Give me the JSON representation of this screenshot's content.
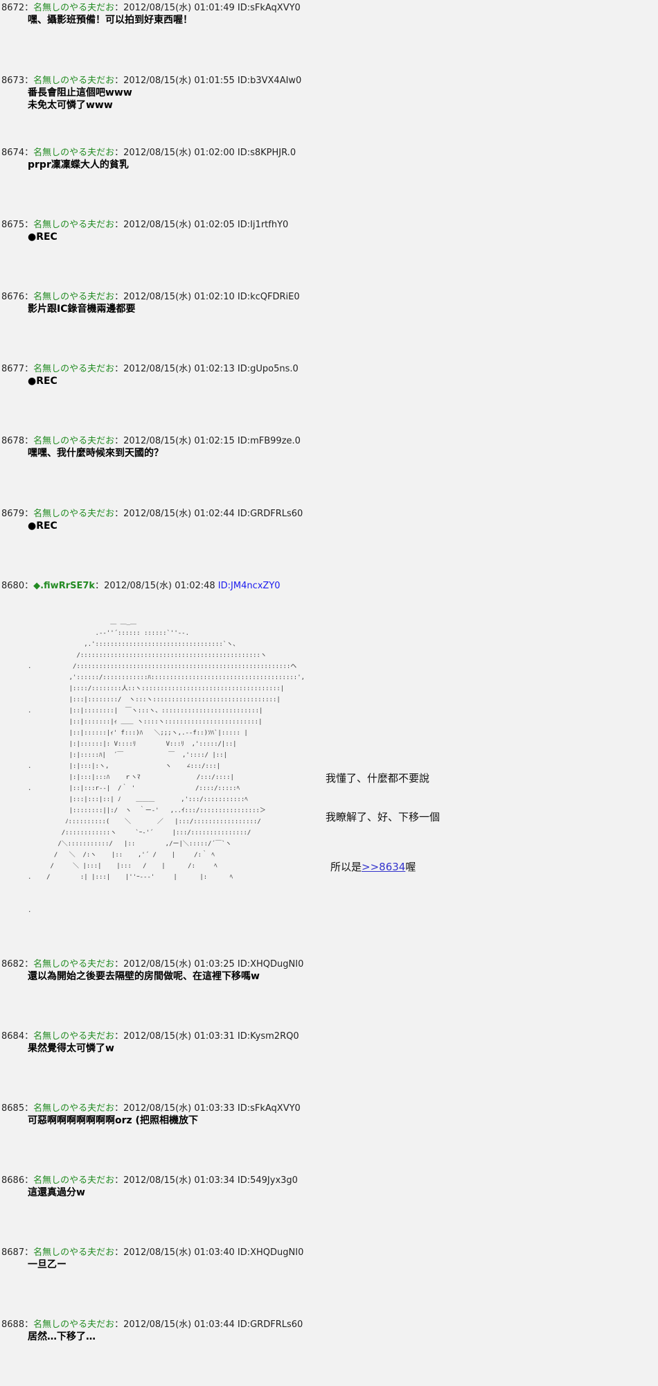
{
  "posts": [
    {
      "num": "8672",
      "name": "名無しのやる夫だお",
      "date": "2012/08/15(水) 01:01:49",
      "id": "ID:sFkAqXVY0",
      "body": "嘿、攝影班預備！可以拍到好東西喔！"
    },
    {
      "num": "8673",
      "name": "名無しのやる夫だお",
      "date": "2012/08/15(水) 01:01:55",
      "id": "ID:b3VX4AIw0",
      "body": "番長會阻止這個吧www\n未免太可憐了www"
    },
    {
      "num": "8674",
      "name": "名無しのやる夫だお",
      "date": "2012/08/15(水) 01:02:00",
      "id": "ID:s8KPHJR.0",
      "body": "prpr凜凜蝶大人的貧乳"
    },
    {
      "num": "8675",
      "name": "名無しのやる夫だお",
      "date": "2012/08/15(水) 01:02:05",
      "id": "ID:Ij1rtfhY0",
      "body": "●REC"
    },
    {
      "num": "8676",
      "name": "名無しのやる夫だお",
      "date": "2012/08/15(水) 01:02:10",
      "id": "ID:kcQFDRiE0",
      "body": "影片跟IC錄音機兩邊都要"
    },
    {
      "num": "8677",
      "name": "名無しのやる夫だお",
      "date": "2012/08/15(水) 01:02:13",
      "id": "ID:gUpo5ns.0",
      "body": "●REC"
    },
    {
      "num": "8678",
      "name": "名無しのやる夫だお",
      "date": "2012/08/15(水) 01:02:15",
      "id": "ID:mFB99ze.0",
      "body": "嘿嘿、我什麼時候來到天國的？"
    },
    {
      "num": "8679",
      "name": "名無しのやる夫だお",
      "date": "2012/08/15(水) 01:02:44",
      "id": "ID:GRDFRLs60",
      "body": "●REC"
    },
    {
      "num": "8680",
      "name": "◆.fiwRrSE7k",
      "date": "2012/08/15(水) 01:02:48",
      "id": "ID:JM4ncxZY0",
      "body": ""
    },
    {
      "num": "8682",
      "name": "名無しのやる夫だお",
      "date": "2012/08/15(水) 01:03:25",
      "id": "ID:XHQDugNI0",
      "body": "還以為開始之後要去隔壁的房間做呢、在這裡下移嗎w"
    },
    {
      "num": "8684",
      "name": "名無しのやる夫だお",
      "date": "2012/08/15(水) 01:03:31",
      "id": "ID:Kysm2RQ0",
      "body": "果然覺得太可憐了w"
    },
    {
      "num": "8685",
      "name": "名無しのやる夫だお",
      "date": "2012/08/15(水) 01:03:33",
      "id": "ID:sFkAqXVY0",
      "body": "可惡啊啊啊啊啊啊啊orz (把照相機放下"
    },
    {
      "num": "8686",
      "name": "名無しのやる夫だお",
      "date": "2012/08/15(水) 01:03:34",
      "id": "ID:549Jyx3g0",
      "body": "這還真過分w"
    },
    {
      "num": "8687",
      "name": "名無しのやる夫だお",
      "date": "2012/08/15(水) 01:03:40",
      "id": "ID:XHQDugNI0",
      "body": "一旦乙ー"
    },
    {
      "num": "8688",
      "name": "名無しのやる夫だお",
      "date": "2012/08/15(水) 01:03:44",
      "id": "ID:GRDFRLs60",
      "body": "居然…下移了…"
    }
  ],
  "sep": "：",
  "art": {
    "line1": "我懂了、什麼都不要說",
    "line2": "我瞭解了、好、下移一個",
    "line3_prefix": "所以是",
    "line3_anchor": ">>8634",
    "line3_suffix": "喔",
    "ascii": "                      ＿ ＿_＿\n                  .-‐''´:::::: ::::::`''‐-.\n               ,.'::::::::::::::::::::::::::::::::::`ヽ、\n             /::::::::::::::::::::::::::::::::::::::::::::::::ヽ\n.           /:::::::::::::::::::::::::::::::::::::::::::::::::::::::::ヘ\n           ,'::::::/::::::::::::ﾊ:::::::::::::::::::::::::::::::::::::::',\n           |::::/::::::::人::ヽ:::::::::::::::::::::::::::::::::::::|\n           |:::|::::::::/  ヽ:::ヽ:::::::::::::::::::::::::::::::::|\n.          |::|::::::::|  ￣ヽ:::ヽ、::::::::::::::::::::::::::|\n           |::|:::::::|ｨ ＿＿ ヽ::::ヽ:::::::::::::::::::::::::|\n           |::|::::::|ｨ' f:::)ﾊ   ＼;;;ヽ,.-‐f::)ｿﾊ`|::::: |\n           |:|::::::|: V::::ﾘ        V:::ﾘ  ,':::::/|::|\n           |:|:::::ﾊ|  ´￣            ￣  ,'::::/ |::|\n.          |:|:::|:ヽ,               ヽ    ∠:::/:::|\n           |:|:::|:::ﾊ    ｒヽﾏ               /:::/::::|\n.          |::|:::r--|  /｀ '                /::::/:::::ﾍ\n           |:::|:::|::| ﾉ    ＿＿＿       ,':::/:::::::::::ﾍ\n           |::::::::||:/  ヽ  ｀ー‐'   ,..ｲ:::/::::::::::::::::＞\n          ﾉ::::::::::(    ＼       ／   |:::/:::::::::::::::::/\n         /::::::::::::ヽ     `ｰ‐'´     |:::/:::::::::::::::/\n        /＼:::::::::::/   |::        ,/ー|＼:::::/´￣`ヽ\n       /   ＼  /:ヽ    |::    ,'´ /    |     /:｀ ﾍ\n      /     ＼ |:::|    |:::   /    |      /:     ﾍ\n.    /        :| |:::|    |''ｰ-‐-'     |      |:      ﾍ\n\n\n."
  }
}
